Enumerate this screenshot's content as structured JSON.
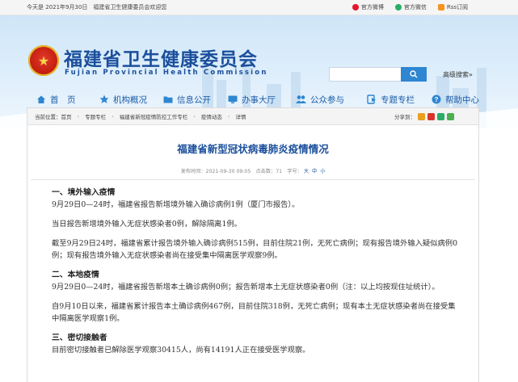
{
  "topbar": {
    "date_text": "今天是 2021年9月30日",
    "welcome": "福建省卫生健康委员会欢迎您",
    "links": [
      {
        "label": "官方微博",
        "icon": "weibo-icon",
        "color": "#e6162d"
      },
      {
        "label": "官方微信",
        "icon": "wechat-icon",
        "color": "#2aae67"
      },
      {
        "label": "Rss订阅",
        "icon": "rss-icon",
        "color": "#f7931e"
      }
    ]
  },
  "header": {
    "title_cn": "福建省卫生健康委员会",
    "title_en": "Fujian Provincial Health Commission",
    "search_placeholder": "",
    "adv_search": "高级搜索»"
  },
  "nav": [
    {
      "label": "首　页",
      "icon": "home-icon"
    },
    {
      "label": "机构概况",
      "icon": "star-icon"
    },
    {
      "label": "信息公开",
      "icon": "folder-icon"
    },
    {
      "label": "办事大厅",
      "icon": "monitor-icon"
    },
    {
      "label": "公众参与",
      "icon": "people-icon"
    },
    {
      "label": "专题专栏",
      "icon": "tag-icon"
    },
    {
      "label": "帮助中心",
      "icon": "help-icon"
    }
  ],
  "breadcrumb": {
    "prefix": "当前位置：",
    "items": [
      "首页",
      "专题专栏",
      "福建省新冠疫情防控工作专栏",
      "疫情动态",
      "详情"
    ],
    "share_label": "分享到："
  },
  "article": {
    "title": "福建省新型冠状病毒肺炎疫情情况",
    "date": "发布时间：2021-09-30 09:05",
    "views": "点击数：71",
    "font_label": "字号：",
    "font_sizes": [
      "大",
      "中",
      "小"
    ],
    "sections": {
      "s1_head": "一、境外输入疫情",
      "s1_p1": "9月29日0—24时，福建省报告新增境外输入确诊病例1例（厦门市报告）。",
      "s1_p2": "当日报告新增境外输入无症状感染者0例，解除隔离1例。",
      "s1_p3": "截至9月29日24时，福建省累计报告境外输入确诊病例515例，目前住院21例，无死亡病例；现有报告境外输入疑似病例0例；现有报告境外输入无症状感染者尚在接受集中隔离医学观察9例。",
      "s2_head": "二、本地疫情",
      "s2_p1": "9月29日0—24时，福建省报告新增本土确诊病例0例；报告新增本土无症状感染者0例（注：以上均按现住址统计）。",
      "s2_p2": "自9月10日以来，福建省累计报告本土确诊病例467例，目前住院318例，无死亡病例；现有本土无症状感染者尚在接受集中隔离医学观察1例。",
      "s3_head": "三、密切接触者",
      "s3_p1": "目前密切接触者已解除医学观察30415人，尚有14191人正在接受医学观察。"
    }
  },
  "colors": {
    "brand_blue": "#1b4f9c",
    "nav_blue": "#1b5ca8",
    "search_blue": "#2f86d1"
  }
}
